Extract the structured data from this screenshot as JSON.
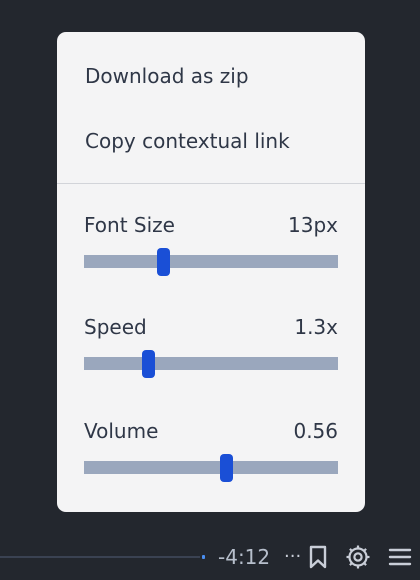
{
  "menu": {
    "items": [
      {
        "label": "Download as zip"
      },
      {
        "label": "Copy contextual link"
      }
    ],
    "settings": [
      {
        "label": "Font Size",
        "value": "13px",
        "level": 0.31
      },
      {
        "label": "Speed",
        "value": "1.3x",
        "level": 0.25
      },
      {
        "label": "Volume",
        "value": "0.56",
        "level": 0.56
      }
    ]
  },
  "player": {
    "time_remaining": "-4:12",
    "more": "···",
    "icons": [
      "bookmark-icon",
      "gear-icon",
      "hamburger-menu-icon"
    ]
  },
  "colors": {
    "slider_thumb": "#1a4fd6",
    "slider_track": "#9aa7bd",
    "menu_background": "#f4f4f5",
    "app_background": "#23272e"
  }
}
